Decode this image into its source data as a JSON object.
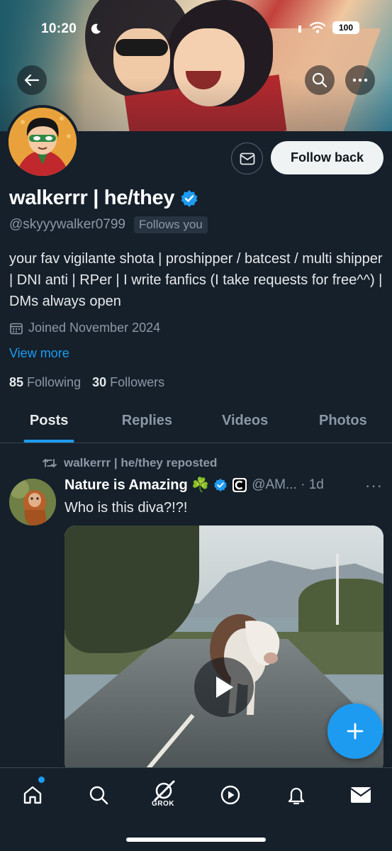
{
  "status_bar": {
    "time": "10:20",
    "battery": "100"
  },
  "profile": {
    "display_name": "walkerrr | he/they",
    "handle": "@skyyywalker0799",
    "follows_you": "Follows you",
    "follow_back_label": "Follow back",
    "bio": "your fav vigilante shota | proshipper / batcest / multi shipper | DNI anti | RPer | I write fanfics (I take requests for free^^) | DMs always open",
    "joined": "Joined November 2024",
    "view_more": "View more",
    "following_count": "85",
    "following_label": "Following",
    "followers_count": "30",
    "followers_label": "Followers"
  },
  "tabs": [
    {
      "label": "Posts",
      "active": true
    },
    {
      "label": "Replies",
      "active": false
    },
    {
      "label": "Videos",
      "active": false
    },
    {
      "label": "Photos",
      "active": false
    }
  ],
  "post": {
    "repost_label": "walkerrr | he/they reposted",
    "author_name": "Nature is Amazing ☘️",
    "handle_time": "@AM... · 1d",
    "more": "···",
    "text": "Who is this diva?!?!"
  },
  "nav": {
    "grok_label": "GROK",
    "items": [
      "home-icon",
      "search-icon",
      "grok-icon",
      "video-icon",
      "bell-icon",
      "mail-icon"
    ]
  },
  "colors": {
    "background": "#15202b",
    "accent": "#1d9bf0",
    "muted_text": "#8b98a5",
    "border": "#38444d"
  }
}
